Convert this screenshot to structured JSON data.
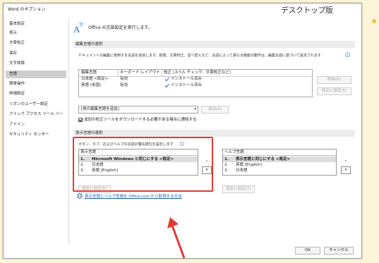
{
  "window": {
    "title": "Word のオプション"
  },
  "badge": "デスクトップ版",
  "sidebar": {
    "items": [
      {
        "label": "基本設定"
      },
      {
        "label": "表示"
      },
      {
        "label": "文章校正"
      },
      {
        "label": "保存"
      },
      {
        "label": "文字体裁"
      },
      {
        "label": "言語"
      },
      {
        "label": "簡単操作"
      },
      {
        "label": "詳細設定"
      },
      {
        "label": "リボンのユーザー設定"
      },
      {
        "label": "クイック アクセス ツール バー"
      },
      {
        "label": "アドイン"
      },
      {
        "label": "セキュリティ センター"
      }
    ]
  },
  "header": {
    "text": "Office の言語設定を実行します。"
  },
  "editing": {
    "section_title": "編集言語の選択",
    "description": "ドキュメントの編集に使用する言語を追加します。辞書、文章校正、並べ替えなど、言語によって異なる機能の動作は、編集言語に基づいて設定されます",
    "columns": [
      "編集言語",
      "キーボード レイアウト",
      "校正 (スペル チェック、文章校正など)"
    ],
    "rows": [
      {
        "lang": "日本語 <既定>",
        "keyboard": "有効",
        "proof": "インストール済み"
      },
      {
        "lang": "英語 (米国)",
        "keyboard": "有効",
        "proof": "インストール済み"
      }
    ],
    "remove_label": "削除(R)",
    "set_default_label": "既定に設定(E)",
    "add_select": "[他の編集言語を追加]",
    "add_label": "追加(A)",
    "checkbox_label": "追加の校正ツールをダウンロードする必要がある場合に通知する"
  },
  "display": {
    "section_title": "表示言語の選択",
    "description": "ボタン、タブ、およびヘルプの言語の優先順位を設定します",
    "display_list": {
      "header": "表示言語",
      "items": [
        {
          "num": "1.",
          "label": "Microsoft Windows と同じにする <既定>"
        },
        {
          "num": "2.",
          "label": "日本語"
        },
        {
          "num": "3.",
          "label": "英語 [English]"
        }
      ],
      "set_default_label": "既定に設定(E)"
    },
    "help_list": {
      "header": "ヘルプ言語",
      "items": [
        {
          "num": "1.",
          "label": "表示言語と同じにする <既定>"
        },
        {
          "num": "2.",
          "label": "英語 [English]"
        },
        {
          "num": "3.",
          "label": "日本語"
        }
      ],
      "set_default_label": "既定に設定(T)"
    },
    "link": "表示言語とヘルプ言語を Office.com から取得する方法"
  },
  "footer": {
    "ok": "OK",
    "cancel": "キャンセル"
  },
  "colors": {
    "highlight": "#e53935",
    "link": "#1f5fb5",
    "check": "#2b6cc4"
  }
}
